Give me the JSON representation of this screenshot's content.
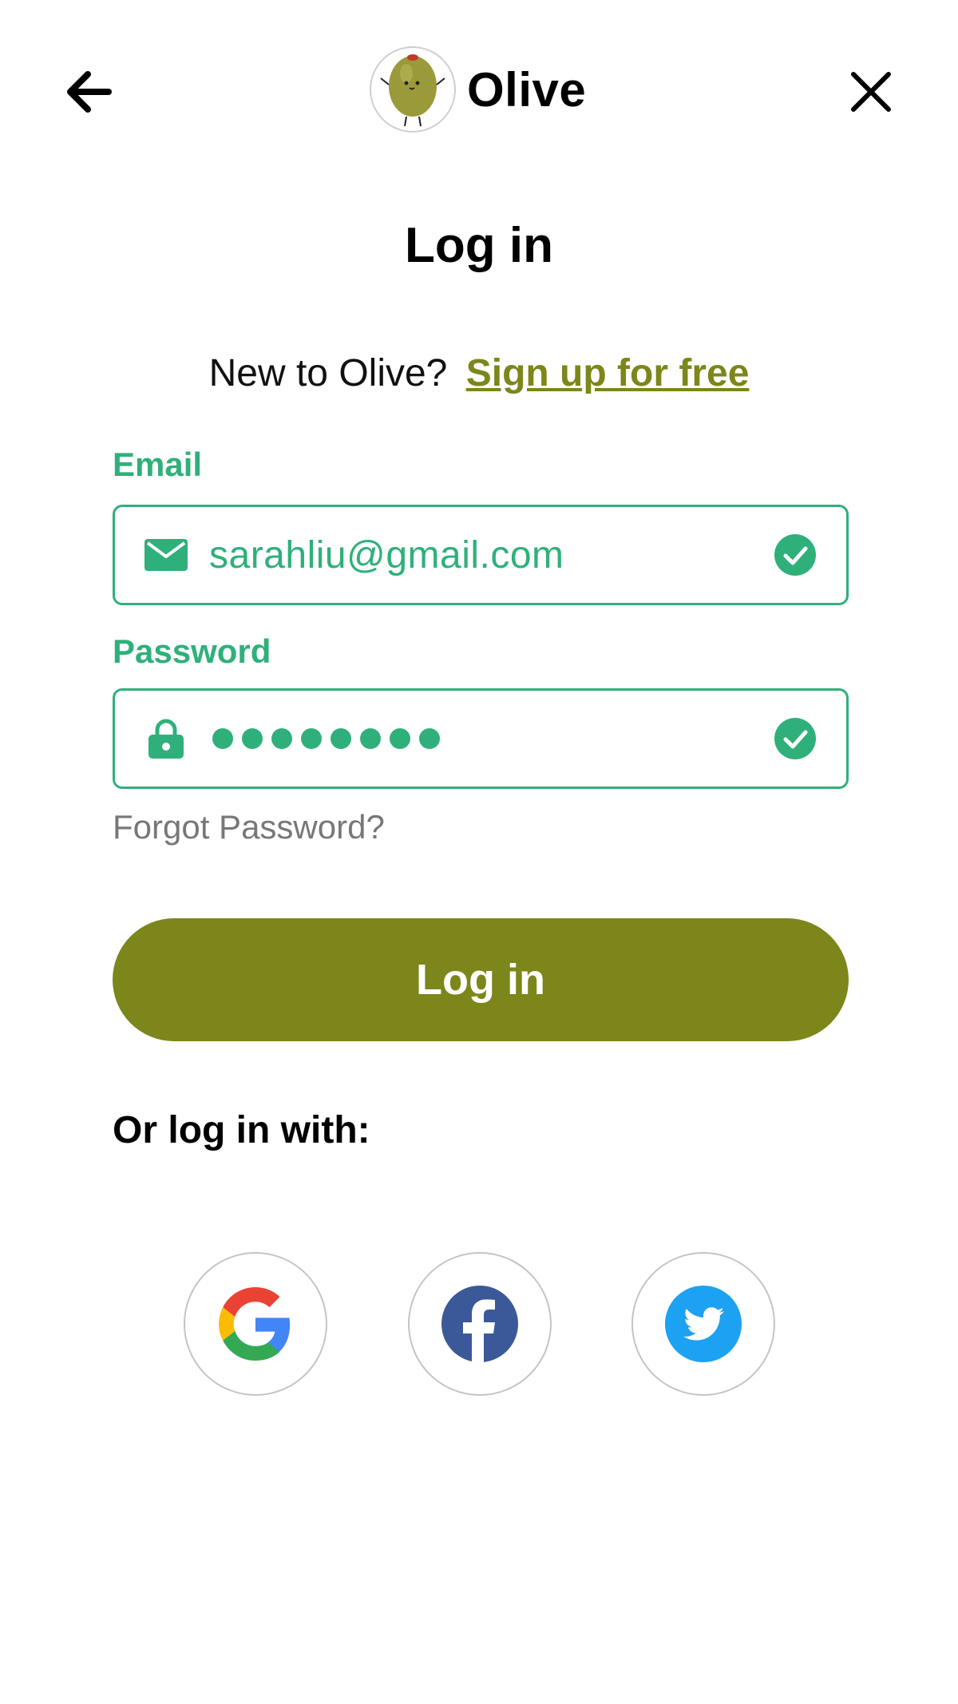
{
  "header": {
    "brand_name": "Olive",
    "back_icon": "arrow-left-icon",
    "close_icon": "close-icon",
    "logo_icon": "olive-mascot-icon"
  },
  "title": "Log in",
  "signup": {
    "prompt": "New to Olive?",
    "link": "Sign up for free"
  },
  "email": {
    "label": "Email",
    "value": "sarahliu@gmail.com",
    "icon": "mail-icon",
    "status_icon": "check-circle-icon"
  },
  "password": {
    "label": "Password",
    "masked_length": 8,
    "icon": "lock-icon",
    "status_icon": "check-circle-icon"
  },
  "forgot_password": "Forgot Password?",
  "login_button": "Log in",
  "alt_login": {
    "label": "Or log in with:",
    "providers": [
      "google-icon",
      "facebook-icon",
      "twitter-icon"
    ]
  },
  "colors": {
    "accent_olive": "#7c861a",
    "valid_green": "#2fb07a",
    "muted_text": "#777777"
  }
}
